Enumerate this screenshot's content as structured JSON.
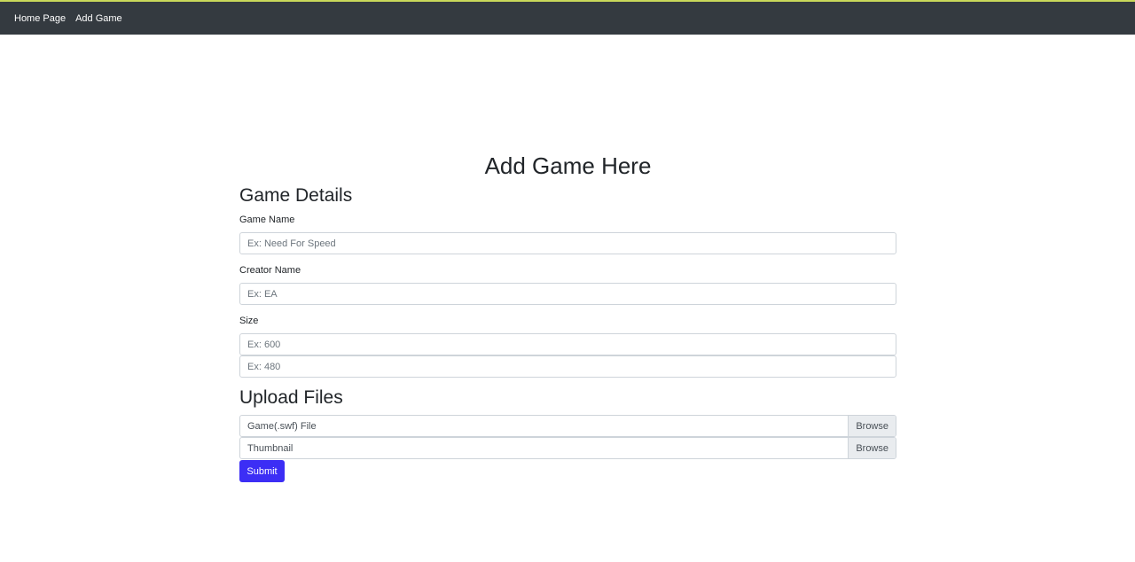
{
  "nav": {
    "items": [
      {
        "label": "Home Page"
      },
      {
        "label": "Add Game"
      }
    ]
  },
  "page": {
    "title": "Add Game Here"
  },
  "game_details": {
    "heading": "Game Details",
    "game_name": {
      "label": "Game Name",
      "placeholder": "Ex: Need For Speed"
    },
    "creator_name": {
      "label": "Creator Name",
      "placeholder": "Ex: EA"
    },
    "size": {
      "label": "Size",
      "width_placeholder": "Ex: 600",
      "height_placeholder": "Ex: 480"
    }
  },
  "upload_files": {
    "heading": "Upload Files",
    "game_file": {
      "label": "Game(.swf) File",
      "button": "Browse"
    },
    "thumbnail": {
      "label": "Thumbnail",
      "button": "Browse"
    }
  },
  "form": {
    "submit_label": "Submit"
  },
  "colors": {
    "navbar": "#343a40",
    "primary_button": "#3c2ef5"
  }
}
